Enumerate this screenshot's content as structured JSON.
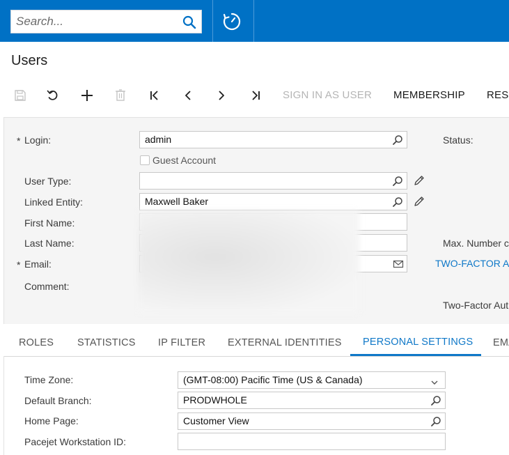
{
  "search": {
    "placeholder": "Search..."
  },
  "page": {
    "title": "Users"
  },
  "toolbar": {
    "sign_in_as_user": "SIGN IN AS USER",
    "membership": "MEMBERSHIP",
    "reset_truncated": "RES"
  },
  "form": {
    "login_label": "Login:",
    "login_value": "admin",
    "guest_account_label": "Guest Account",
    "user_type_label": "User Type:",
    "user_type_value": "",
    "linked_entity_label": "Linked Entity:",
    "linked_entity_value": "Maxwell Baker",
    "first_name_label": "First Name:",
    "last_name_label": "Last Name:",
    "email_label": "Email:",
    "comment_label": "Comment:",
    "required_marker": "*",
    "status_label": "Status:",
    "max_number_label_truncated": "Max. Number c",
    "two_factor_link_truncated": "TWO-FACTOR A",
    "two_factor_auth_label_truncated": "Two-Factor Aut"
  },
  "tabs": [
    {
      "label": "ROLES"
    },
    {
      "label": "STATISTICS"
    },
    {
      "label": "IP FILTER"
    },
    {
      "label": "EXTERNAL IDENTITIES"
    },
    {
      "label": "PERSONAL SETTINGS",
      "active": true
    },
    {
      "label": "EMA"
    }
  ],
  "personal_settings": {
    "time_zone_label": "Time Zone:",
    "time_zone_value": "(GMT-08:00) Pacific Time (US & Canada)",
    "default_branch_label": "Default Branch:",
    "default_branch_value": "PRODWHOLE",
    "home_page_label": "Home Page:",
    "home_page_value": "Customer View",
    "pacejet_label": "Pacejet Workstation ID:",
    "pacejet_value": ""
  },
  "colors": {
    "topbar": "#0071c5",
    "accent": "#0f78c8",
    "panel": "#f5f5f5"
  }
}
